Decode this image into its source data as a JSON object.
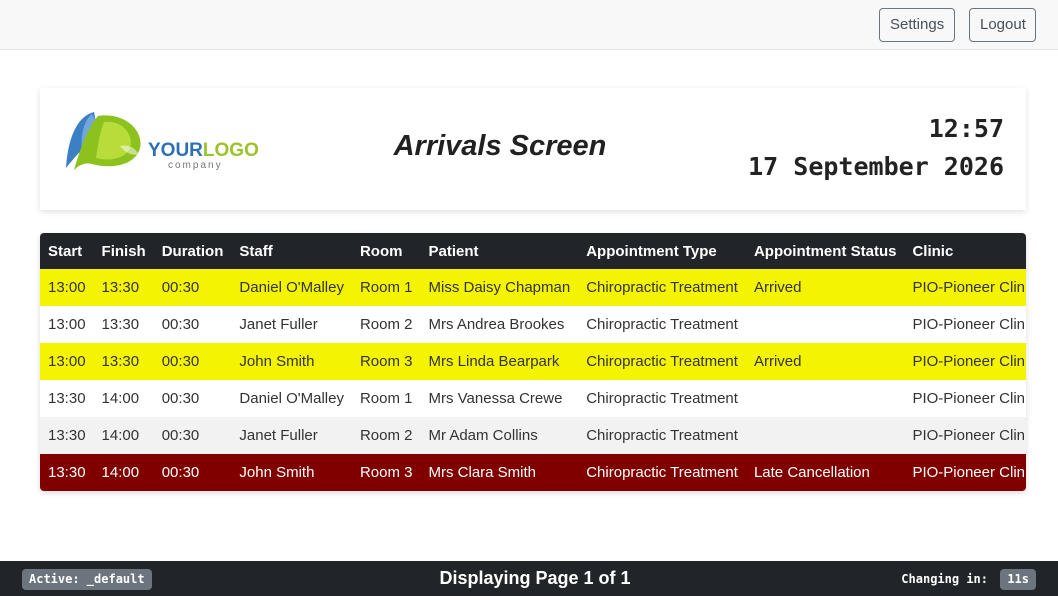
{
  "topbar": {
    "settings_label": "Settings",
    "logout_label": "Logout"
  },
  "header": {
    "logo": {
      "word1": "YOUR",
      "word2": "LOGO",
      "sub": "company"
    },
    "title": "Arrivals Screen",
    "time": "12:57",
    "date": "17 September 2026"
  },
  "table": {
    "columns": [
      "Start",
      "Finish",
      "Duration",
      "Staff",
      "Room",
      "Patient",
      "Appointment Type",
      "Appointment Status",
      "Clinic"
    ],
    "rows": [
      {
        "start": "13:00",
        "finish": "13:30",
        "duration": "00:30",
        "staff": "Daniel O'Malley",
        "room": "Room 1",
        "patient": "Miss Daisy Chapman",
        "type": "Chiropractic Treatment",
        "status": "Arrived",
        "clinic": "PIO-Pioneer Clinic",
        "style": "arrived"
      },
      {
        "start": "13:00",
        "finish": "13:30",
        "duration": "00:30",
        "staff": "Janet Fuller",
        "room": "Room 2",
        "patient": "Mrs Andrea Brookes",
        "type": "Chiropractic Treatment",
        "status": "",
        "clinic": "PIO-Pioneer Clinic",
        "style": "plain"
      },
      {
        "start": "13:00",
        "finish": "13:30",
        "duration": "00:30",
        "staff": "John Smith",
        "room": "Room 3",
        "patient": "Mrs Linda Bearpark",
        "type": "Chiropractic Treatment",
        "status": "Arrived",
        "clinic": "PIO-Pioneer Clinic",
        "style": "arrived"
      },
      {
        "start": "13:30",
        "finish": "14:00",
        "duration": "00:30",
        "staff": "Daniel O'Malley",
        "room": "Room 1",
        "patient": "Mrs Vanessa Crewe",
        "type": "Chiropractic Treatment",
        "status": "",
        "clinic": "PIO-Pioneer Clinic",
        "style": "plain"
      },
      {
        "start": "13:30",
        "finish": "14:00",
        "duration": "00:30",
        "staff": "Janet Fuller",
        "room": "Room 2",
        "patient": "Mr Adam Collins",
        "type": "Chiropractic Treatment",
        "status": "",
        "clinic": "PIO-Pioneer Clinic",
        "style": "alt"
      },
      {
        "start": "13:30",
        "finish": "14:00",
        "duration": "00:30",
        "staff": "John Smith",
        "room": "Room 3",
        "patient": "Mrs Clara Smith",
        "type": "Chiropractic Treatment",
        "status": "Late Cancellation",
        "clinic": "PIO-Pioneer Clinic",
        "style": "cancel"
      }
    ]
  },
  "footer": {
    "active_label": "Active: _default",
    "page_text": "Displaying Page 1 of 1",
    "changing_label": "Changing in:",
    "countdown": "11s"
  },
  "colors": {
    "arrived_row": "#f4f400",
    "cancel_row": "#800000",
    "header_dark": "#212529"
  }
}
